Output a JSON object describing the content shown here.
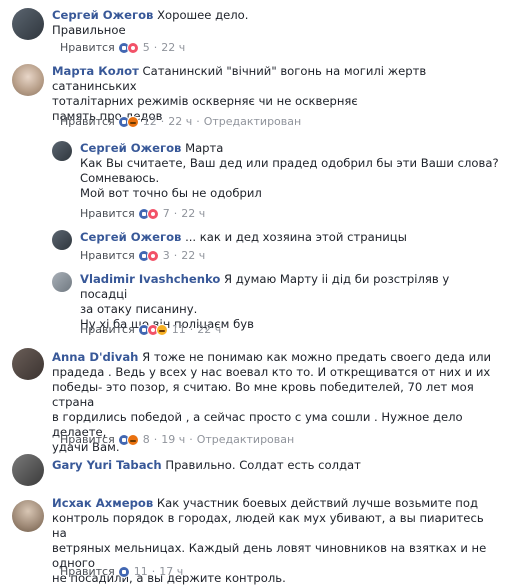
{
  "ui": {
    "like_label": "Нравится",
    "edited_label": "Отредактирован"
  },
  "comments": [
    {
      "author": "Сергей Ожегов",
      "text_lines": [
        "Хорошее дело.",
        "Правильное"
      ],
      "reaction_count": "5",
      "time": "22 ч"
    },
    {
      "author": "Марта Колот",
      "text_lines": [
        "Сатанинский \"вічний\" вогонь на могилі жертв сатанинських",
        "тоталітарних режимів оскверняє чи не оскверняє",
        "память про дедов"
      ],
      "reaction_count": "12",
      "time": "22 ч"
    },
    {
      "author": "Сергей Ожегов",
      "text_lines": [
        "Марта",
        "Как Вы считаете, Ваш дед или прадед одобрил бы эти Ваши слова?",
        "Сомневаюсь.",
        "Мой вот точно бы не одобрил"
      ],
      "reaction_count": "7",
      "time": "22 ч"
    },
    {
      "author": "Сергей Ожегов",
      "text_lines": [
        "... как и дед хозяина этой страницы"
      ],
      "reaction_count": "3",
      "time": "22 ч"
    },
    {
      "author": "Vladimir Ivashchenko",
      "text_lines": [
        "Я думаю Марту іі дід би розстріляв у посадці",
        "за отаку писанину.",
        "Ну хі ба що він поліцаєм був"
      ],
      "reaction_count": "11",
      "time": "22 ч"
    },
    {
      "author": "Anna D'divah",
      "text_lines": [
        "Я тоже не понимаю как можно предать своего деда или",
        "прадеда . Ведь у всех у нас воевал кто то. И открещиватся от них и их",
        "победы- это позор, я считаю. Во мне кровь победителей, 70 лет моя страна",
        "в гордились победой , а сейчас просто с ума сошли . Нужное дело делаете,",
        "удачи Вам."
      ],
      "reaction_count": "8",
      "time": "19 ч"
    },
    {
      "author": "Gary Yuri Tabach",
      "text_lines": [
        "Правильно. Солдат есть солдат"
      ],
      "reaction_count": "",
      "time": ""
    },
    {
      "author": "Исхак Ахмеров",
      "text_lines": [
        "Как участник боевых действий лучше возьмите под",
        "контроль порядок в городах, людей как мух убивают, а вы пиаритесь на",
        "ветряных мельницах. Каждый день ловят чиновников на взятках и не одного",
        "не посадили, а вы держите контроль."
      ],
      "reaction_count": "11",
      "time": "17 ч"
    }
  ],
  "colors": {
    "name": "#385898",
    "meta": "#90949c",
    "link": "#4b4f56",
    "like": "#4267b2",
    "heart": "#f25268",
    "haha": "#f7b125",
    "angry": "#e9710f"
  }
}
